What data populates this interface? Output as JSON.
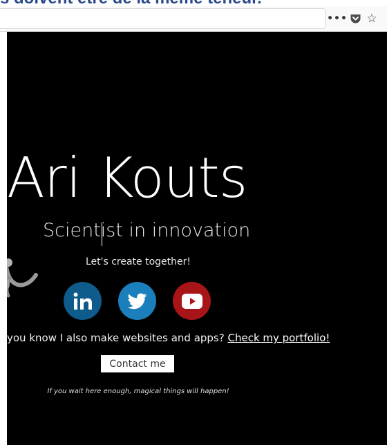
{
  "document_heading": "s doivent être de la même teneur.",
  "browser": {
    "toolbar_icons": [
      "more-icon",
      "pocket-icon",
      "star-icon"
    ],
    "more_glyph": "•••",
    "star_glyph": "☆"
  },
  "page": {
    "title": "Ari Kouts",
    "subtitle": "Scientist in innovation",
    "tagline": "Let's create together!",
    "social": [
      {
        "name": "LinkedIn",
        "color": "#0e5b8c"
      },
      {
        "name": "Twitter",
        "color": "#1a7fbb"
      },
      {
        "name": "YouTube",
        "color": "#a71519"
      }
    ],
    "portfolio_text": "Did you know I also make websites and apps?",
    "portfolio_link": "Check my portfolio!",
    "contact_label": "Contact me",
    "footnote": "If you wait here enough, magical things will happen!"
  },
  "colors": {
    "background": "#000000",
    "text": "#ffffff",
    "contact_button_bg": "#ffffff"
  }
}
